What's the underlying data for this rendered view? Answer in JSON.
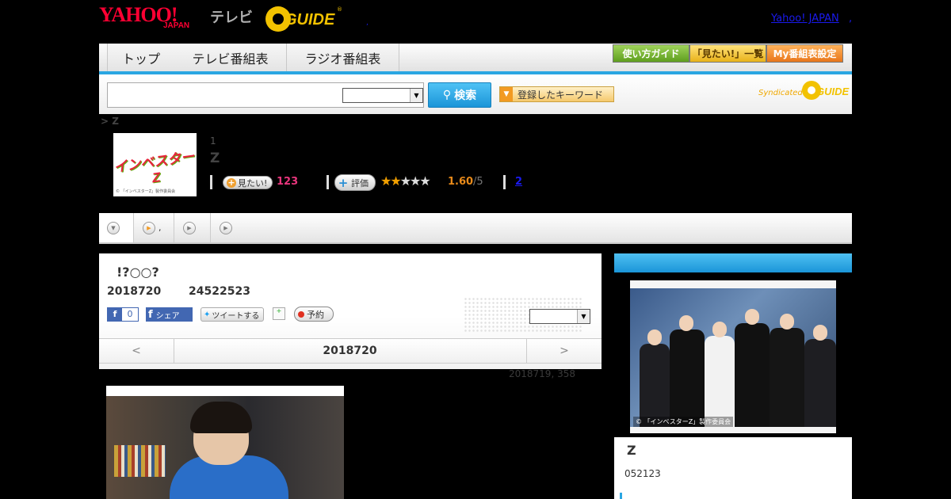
{
  "header": {
    "logo_yahoo": "YAHOO!",
    "logo_japan": "JAPAN",
    "logo_tv": "テレビ",
    "logo_gguide": "GUIDE",
    "logo_reg": "®",
    "yahoo_japan_link": "Yahoo! JAPAN",
    "link_sep": ",",
    "small_dot": ","
  },
  "nav": {
    "tabs": [
      "トップ",
      "テレビ番組表",
      "ラジオ番組表"
    ],
    "guide_buttons": [
      "使い方ガイド",
      "「見たい!」一覧",
      "My番組表設定"
    ]
  },
  "search": {
    "input_value": "",
    "select_value": "",
    "button_label": "検索",
    "keyword_button": "登録したキーワード",
    "syndicated_label": "Syndicated",
    "syndicated_logo": "GUIDE",
    "colors": {
      "accent": "#2aa6e2",
      "gold": "#f2c200"
    }
  },
  "breadcrumb": "> Z",
  "program": {
    "thumb_title": "インベスターZ",
    "thumb_copy": "© 「インベスターZ」製作委員会",
    "episode": "1",
    "title": "Z",
    "mitai_label": "見たい!",
    "mitai_count": "123",
    "hyoka_label": "評価",
    "rating": "1.60",
    "rating_max": "/5",
    "rating_stars_filled": 1.6,
    "rating_stars_total": 5,
    "review_count": "2"
  },
  "subtabs": [
    {
      "label": ""
    },
    {
      "label": ","
    },
    {
      "label": ""
    },
    {
      "label": ""
    }
  ],
  "detail": {
    "title": "!?○○?",
    "date": "2018720",
    "time": "24522523",
    "fb_like_count": "0",
    "fb_share": "シェア",
    "tweet": "ツイートする",
    "reserve": "予約",
    "select_value": "",
    "nav_prev": "<",
    "nav_date": "2018720",
    "nav_next": ">"
  },
  "updated": "2018719, 358",
  "sidebar": {
    "photo_copy": "© 「インベスターZ」製作委員会",
    "title": "Z",
    "date": "052123"
  }
}
